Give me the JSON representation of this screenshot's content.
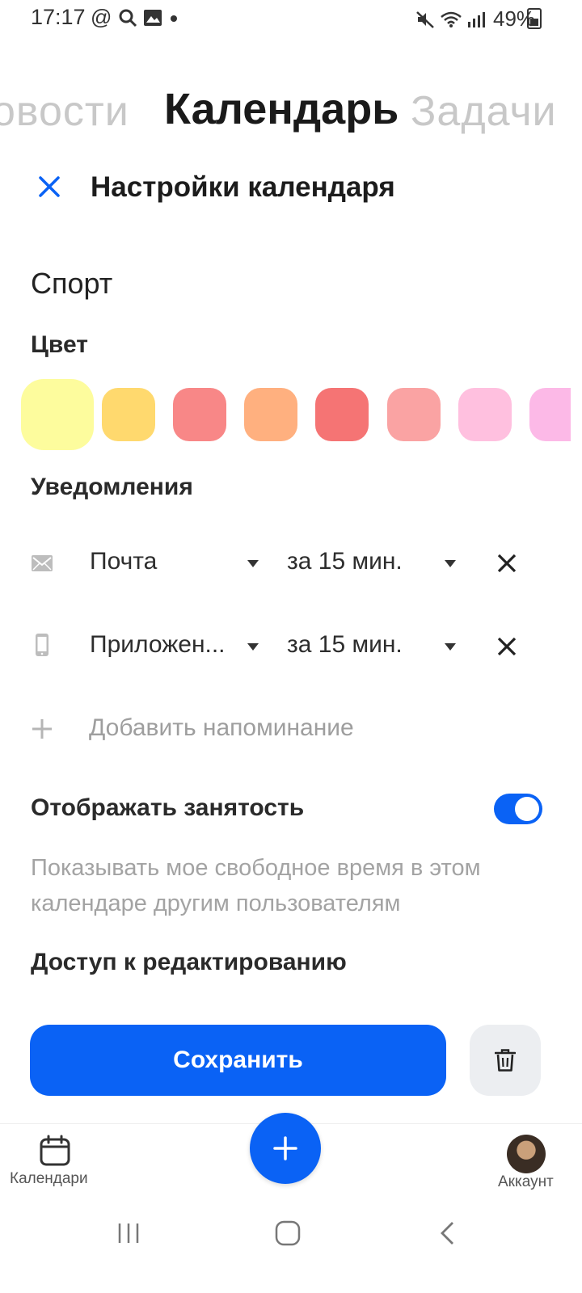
{
  "status_bar": {
    "time": "17:17",
    "battery": "49%",
    "icons": [
      "at-icon",
      "search-icon",
      "image-icon",
      "dot-icon",
      "mute-icon",
      "wifi-icon",
      "signal-icon",
      "battery-icon"
    ]
  },
  "top_tabs": {
    "prev": "овости",
    "current": "Календарь",
    "next": "Задачи"
  },
  "header": {
    "title": "Настройки календаря"
  },
  "calendar": {
    "name": "Спорт"
  },
  "color_section": {
    "label": "Цвет",
    "swatches": [
      "#fdfc9d",
      "#ffd96e",
      "#f88787",
      "#ffb07f",
      "#f57474",
      "#faa3a3",
      "#ffc0df",
      "#fcb9e7"
    ],
    "selected_index": 0
  },
  "notifications": {
    "label": "Уведомления",
    "rows": [
      {
        "icon": "mail-icon",
        "type": "Почта",
        "time": "за 15 мин."
      },
      {
        "icon": "phone-icon",
        "type": "Приложен...",
        "time": "за 15 мин."
      }
    ],
    "add_label": "Добавить напоминание"
  },
  "busy": {
    "label": "Отображать занятость",
    "enabled": true,
    "description": "Показывать мое свободное время в этом календаре другим пользователям"
  },
  "edit_access": {
    "label": "Доступ к редактированию"
  },
  "actions": {
    "save_label": "Сохранить"
  },
  "bottom_nav": {
    "calendars_label": "Календари",
    "account_label": "Аккаунт"
  },
  "colors": {
    "accent": "#0a62f5"
  }
}
